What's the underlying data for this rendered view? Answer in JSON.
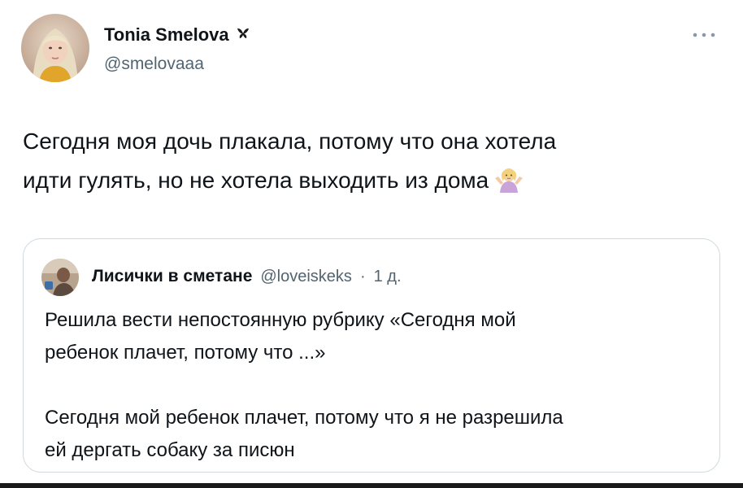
{
  "tweet": {
    "author": {
      "display_name": "Tonia Smelova",
      "handle": "@smelovaaa"
    },
    "more_icon": "more-horizontal-icon",
    "text_lines": [
      "Сегодня моя дочь плакала, потому что она хотела",
      "идти гулять, но не хотела выходить из дома"
    ],
    "emoji": "person-shrugging-emoji"
  },
  "quoted_tweet": {
    "author": {
      "display_name": "Лисички в сметане",
      "handle": "@loveiskeks"
    },
    "separator": "·",
    "time": "1 д.",
    "paragraph_1_lines": [
      "Решила вести непостоянную рубрику «Сегодня мой",
      "ребенок плачет, потому что ...»"
    ],
    "paragraph_2_lines": [
      "Сегодня мой ребенок плачет, потому что я не разрешила",
      "ей дергать собаку за писюн"
    ]
  },
  "colors": {
    "text": "#0f1419",
    "secondary": "#536471",
    "border": "#cfd9de"
  }
}
